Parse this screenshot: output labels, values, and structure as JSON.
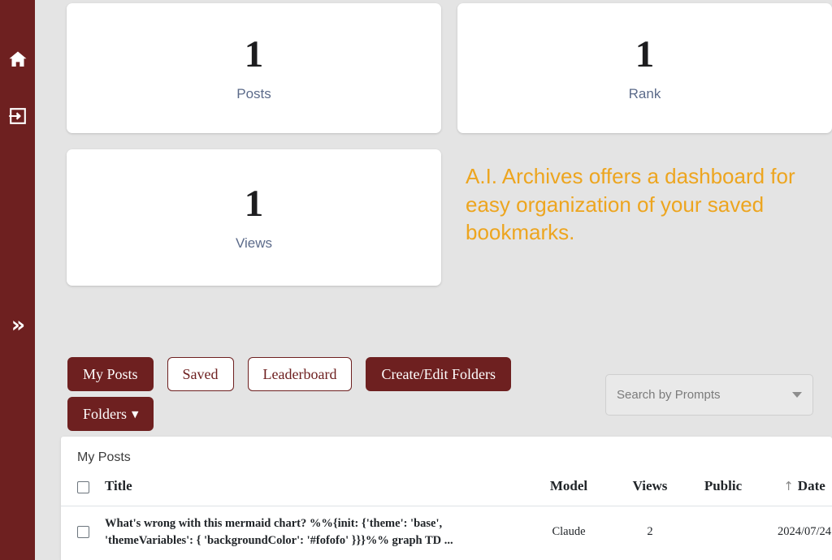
{
  "sidebar": {
    "items": [
      {
        "name": "home",
        "icon": "home-icon"
      },
      {
        "name": "login",
        "icon": "login-icon"
      }
    ],
    "expand": {
      "glyph": "»",
      "label": "expand-sidebar"
    }
  },
  "stats": [
    {
      "value": "1",
      "label": "Posts"
    },
    {
      "value": "1",
      "label": "Rank"
    },
    {
      "value": "1",
      "label": "Views"
    }
  ],
  "tagline": "A.I. Archives offers a dashboard for easy organization of your saved bookmarks.",
  "toolbar": {
    "my_posts": "My Posts",
    "saved": "Saved",
    "leaderboard": "Leaderboard",
    "create_edit_folders": "Create/Edit Folders",
    "folders": "Folders",
    "folders_caret": "▼"
  },
  "search": {
    "placeholder": "Search by Prompts",
    "caret": "caret-down-icon"
  },
  "table": {
    "caption": "My Posts",
    "columns": {
      "title": "Title",
      "model": "Model",
      "views": "Views",
      "public": "Public",
      "date": "Date"
    },
    "sort": {
      "column": "Date",
      "direction_glyph": "↑"
    },
    "rows": [
      {
        "title": "What's wrong with this mermaid chart? %%{init: {'theme': 'base', 'themeVariables': { 'backgroundColor': '#fofofo' }}}%% graph TD ...",
        "model": "Claude",
        "views": "2",
        "public": "",
        "date": "2024/07/24"
      }
    ]
  },
  "colors": {
    "brand_maroon": "#6e2020",
    "accent_orange": "#eda51f",
    "page_background": "#e4e4e4",
    "stat_label": "#5c6b8a"
  }
}
